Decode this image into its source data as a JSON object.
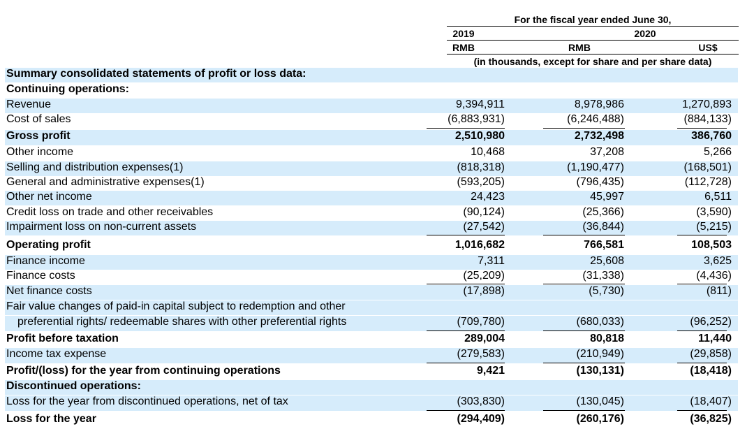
{
  "header": {
    "fiscal_year_title": "For the fiscal year ended June 30,",
    "year_2019": "2019",
    "year_2020": "2020",
    "currency_rmb_2019": "RMB",
    "currency_rmb_2020": "RMB",
    "currency_usd": "US$",
    "units_note": "(in thousands, except for share and per share data)"
  },
  "rows": [
    {
      "label": "Summary consolidated statements of profit or loss data:",
      "bold": true,
      "values": [
        "",
        "",
        ""
      ]
    },
    {
      "label": "Continuing operations:",
      "bold": true,
      "values": [
        "",
        "",
        ""
      ]
    },
    {
      "label": "Revenue",
      "values": [
        "9,394,911",
        "8,978,986",
        "1,270,893"
      ]
    },
    {
      "label": "Cost of sales",
      "values": [
        "(6,883,931)",
        "(6,246,488)",
        "(884,133)"
      ],
      "underline": true
    },
    {
      "label": "Gross profit",
      "bold": true,
      "values": [
        "2,510,980",
        "2,732,498",
        "386,760"
      ]
    },
    {
      "label": "Other income",
      "values": [
        "10,468",
        "37,208",
        "5,266"
      ]
    },
    {
      "label": "Selling and distribution expenses(1)",
      "values": [
        "(818,318)",
        "(1,190,477)",
        "(168,501)"
      ]
    },
    {
      "label": "General and administrative expenses(1)",
      "values": [
        "(593,205)",
        "(796,435)",
        "(112,728)"
      ]
    },
    {
      "label": "Other net income",
      "values": [
        "24,423",
        "45,997",
        "6,511"
      ]
    },
    {
      "label": "Credit loss on trade and other receivables",
      "values": [
        "(90,124)",
        "(25,366)",
        "(3,590)"
      ]
    },
    {
      "label": "Impairment loss on non-current assets",
      "values": [
        "(27,542)",
        "(36,844)",
        "(5,215)"
      ],
      "underline": true
    },
    {
      "label": "Operating profit",
      "bold": true,
      "values": [
        "1,016,682",
        "766,581",
        "108,503"
      ]
    },
    {
      "label": "Finance income",
      "values": [
        "7,311",
        "25,608",
        "3,625"
      ]
    },
    {
      "label": "Finance costs",
      "values": [
        "(25,209)",
        "(31,338)",
        "(4,436)"
      ],
      "underline": true
    },
    {
      "label": "Net finance costs",
      "values": [
        "(17,898)",
        "(5,730)",
        "(811)"
      ]
    },
    {
      "label": "Fair value changes of paid-in capital subject to redemption and other",
      "values": [
        "",
        "",
        ""
      ]
    },
    {
      "label": "preferential rights/ redeemable shares with other preferential rights",
      "indent": true,
      "values": [
        "(709,780)",
        "(680,033)",
        "(96,252)"
      ],
      "underline": true
    },
    {
      "label": "Profit before taxation",
      "bold": true,
      "values": [
        "289,004",
        "80,818",
        "11,440"
      ]
    },
    {
      "label": "Income tax expense",
      "values": [
        "(279,583)",
        "(210,949)",
        "(29,858)"
      ],
      "underline": true
    },
    {
      "label": "Profit/(loss) for the year from continuing operations",
      "bold": true,
      "values": [
        "9,421",
        "(130,131)",
        "(18,418)"
      ]
    },
    {
      "label": "Discontinued operations:",
      "bold": true,
      "values": [
        "",
        "",
        ""
      ]
    },
    {
      "label": "Loss for the year from discontinued operations, net of tax",
      "values": [
        "(303,830)",
        "(130,045)",
        "(18,407)"
      ],
      "underline": true
    },
    {
      "label": "Loss for the year",
      "bold": true,
      "values": [
        "(294,409)",
        "(260,176)",
        "(36,825)"
      ]
    }
  ]
}
